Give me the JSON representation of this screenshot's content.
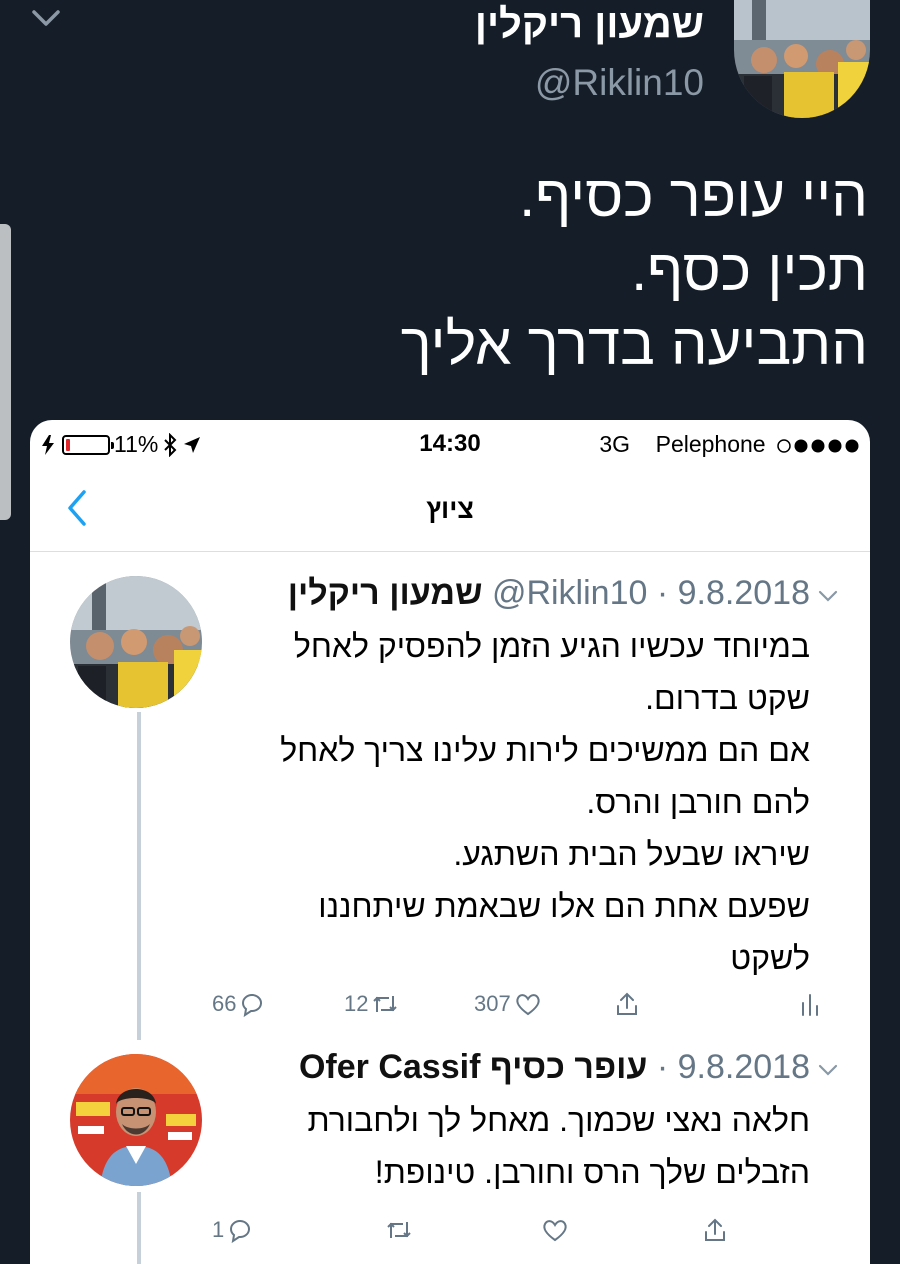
{
  "outer_tweet": {
    "author_name": "שמעון ריקלין",
    "handle": "@Riklin10",
    "text_lines": [
      "היי עופר כסיף.",
      "תכין כסף.",
      "התביעה בדרך אליך"
    ]
  },
  "screenshot": {
    "status_bar": {
      "battery": "11%",
      "battery_level": 0.11,
      "time": "14:30",
      "network": "3G",
      "carrier": "Pelephone"
    },
    "nav": {
      "title": "ציוץ"
    },
    "tweets": [
      {
        "author_name": "שמעון ריקלין",
        "handle": "@Riklin10",
        "date": "9.8.2018",
        "lines": [
          "במיוחד עכשיו הגיע הזמן להפסיק לאחל",
          "שקט בדרום.",
          "אם הם ממשיכים לירות עלינו צריך לאחל",
          "להם חורבן והרס.",
          "שיראו שבעל הבית השתגע.",
          "שפעם אחת הם אלו שבאמת שיתחננו",
          "לשקט"
        ],
        "replies": "66",
        "retweets": "12",
        "likes": "307"
      },
      {
        "author_name": "Ofer Cassif עופר כסיף",
        "date": "9.8.2018",
        "lines": [
          "חלאה נאצי שכמוך. מאחל לך ולחבורת",
          "הזבלים שלך הרס וחורבן. טינופת!"
        ],
        "replies": "1",
        "retweets": "",
        "likes": ""
      }
    ]
  },
  "colors": {
    "background": "#151e28",
    "card": "#ffffff",
    "twitter_blue": "#1da1f2",
    "muted": "#657786",
    "battery_low": "#e0252b"
  },
  "icons": [
    "chevron-down-icon",
    "back-chevron-icon",
    "reply-icon",
    "retweet-icon",
    "like-icon",
    "share-icon",
    "analytics-icon",
    "bluetooth-icon",
    "location-icon",
    "signal-dots-icon",
    "charging-icon"
  ]
}
